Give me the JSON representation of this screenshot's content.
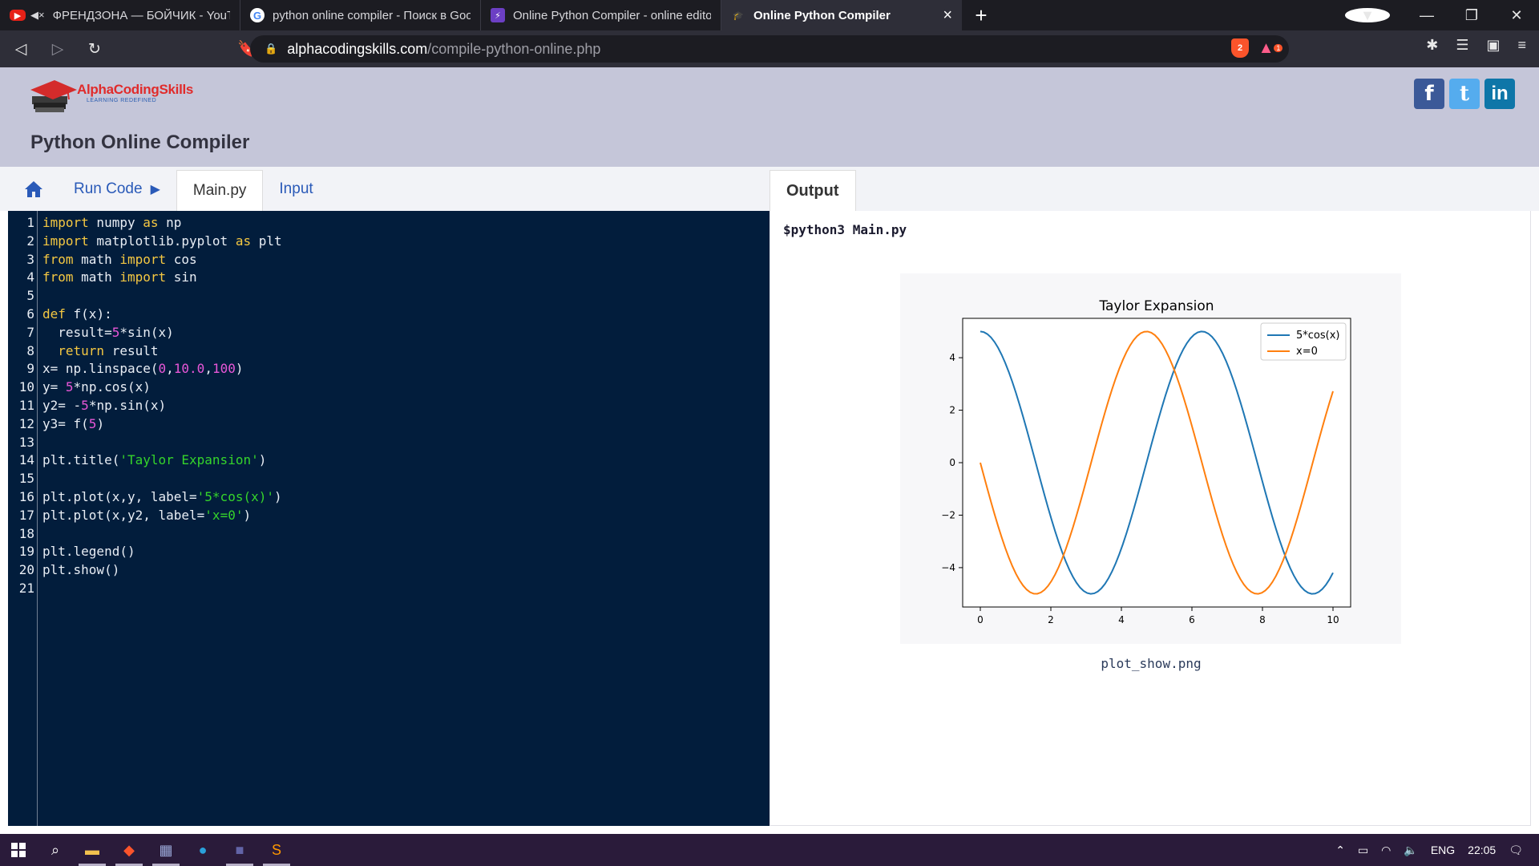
{
  "browser": {
    "tabs": [
      {
        "title": "ФРЕНДЗОНА — БОЙЧИК - YouTube",
        "favicon": "youtube-icon",
        "muted": true
      },
      {
        "title": "python online compiler - Поиск в Google",
        "favicon": "google-icon"
      },
      {
        "title": "Online Python Compiler - online editor",
        "favicon": "bolt-icon"
      },
      {
        "title": "Online Python Compiler",
        "favicon": "alphacodingskills-icon",
        "active": true
      }
    ],
    "url_domain": "alphacodingskills.com",
    "url_path": "/compile-python-online.php",
    "shield_count": "2",
    "rewards_count": "1"
  },
  "site": {
    "logo_text": "AlphaCodingSkills",
    "logo_subtext": "LEARNING REDEFINED",
    "page_title": "Python Online Compiler",
    "socials": [
      "f",
      "t",
      "in"
    ]
  },
  "editor_tabs": {
    "run_label": "Run Code",
    "main_label": "Main.py",
    "input_label": "Input"
  },
  "output_tab": "Output",
  "code_lines": [
    [
      [
        "kw",
        "import"
      ],
      [
        "t",
        " numpy "
      ],
      [
        "kw",
        "as"
      ],
      [
        "t",
        " np"
      ]
    ],
    [
      [
        "kw",
        "import"
      ],
      [
        "t",
        " matplotlib.pyplot "
      ],
      [
        "kw",
        "as"
      ],
      [
        "t",
        " plt"
      ]
    ],
    [
      [
        "kw",
        "from"
      ],
      [
        "t",
        " math "
      ],
      [
        "kw",
        "import"
      ],
      [
        "t",
        " cos"
      ]
    ],
    [
      [
        "kw",
        "from"
      ],
      [
        "t",
        " math "
      ],
      [
        "kw",
        "import"
      ],
      [
        "t",
        " sin"
      ]
    ],
    [],
    [
      [
        "kw",
        "def"
      ],
      [
        "t",
        " f(x):"
      ]
    ],
    [
      [
        "t",
        "  result="
      ],
      [
        "num",
        "5"
      ],
      [
        "t",
        "*sin(x)"
      ]
    ],
    [
      [
        "t",
        "  "
      ],
      [
        "kw",
        "return"
      ],
      [
        "t",
        " result"
      ]
    ],
    [
      [
        "t",
        "x= np.linspace("
      ],
      [
        "num",
        "0"
      ],
      [
        "t",
        ","
      ],
      [
        "num",
        "10.0"
      ],
      [
        "t",
        ","
      ],
      [
        "num",
        "100"
      ],
      [
        "t",
        ")"
      ]
    ],
    [
      [
        "t",
        "y= "
      ],
      [
        "num",
        "5"
      ],
      [
        "t",
        "*np.cos(x)"
      ]
    ],
    [
      [
        "t",
        "y2= -"
      ],
      [
        "num",
        "5"
      ],
      [
        "t",
        "*np.sin(x)"
      ]
    ],
    [
      [
        "t",
        "y3= f("
      ],
      [
        "num",
        "5"
      ],
      [
        "t",
        ")"
      ]
    ],
    [],
    [
      [
        "t",
        "plt.title("
      ],
      [
        "str",
        "'Taylor Expansion'"
      ],
      [
        "t",
        ")"
      ]
    ],
    [],
    [
      [
        "t",
        "plt.plot(x,y, label="
      ],
      [
        "str",
        "'5*cos(x)'"
      ],
      [
        "t",
        ")"
      ]
    ],
    [
      [
        "t",
        "plt.plot(x,y2, label="
      ],
      [
        "str",
        "'x=0'"
      ],
      [
        "t",
        ")"
      ]
    ],
    [],
    [
      [
        "t",
        "plt.legend()"
      ]
    ],
    [
      [
        "t",
        "plt.show()"
      ]
    ],
    []
  ],
  "output": {
    "command": "$python3 Main.py",
    "image_caption": "plot_show.png"
  },
  "chart_data": {
    "type": "line",
    "title": "Taylor Expansion",
    "xlabel": "",
    "ylabel": "",
    "xlim": [
      -0.5,
      10.5
    ],
    "ylim": [
      -5.5,
      5.5
    ],
    "xticks": [
      0,
      2,
      4,
      6,
      8,
      10
    ],
    "xtick_labels": [
      "0",
      "2",
      "4",
      "6",
      "8",
      "10"
    ],
    "yticks": [
      4,
      2,
      0,
      -2,
      -4
    ],
    "ytick_labels": [
      "4",
      "2",
      "0",
      "−2",
      "−4"
    ],
    "legend_position": "top-right",
    "grid": false,
    "x_range": [
      0,
      10
    ],
    "n_points": 100,
    "series": [
      {
        "name": "5*cos(x)",
        "expression": "5*cos(x)",
        "color": "#1f77b4"
      },
      {
        "name": "x=0",
        "expression": "-5*sin(x)",
        "color": "#ff7f0e"
      }
    ]
  },
  "taskbar": {
    "language": "ENG",
    "time": "22:05"
  },
  "colors": {
    "editor_bg": "#021d3c",
    "keyword": "#f5c842",
    "number": "#e957d8",
    "string": "#35d42b",
    "header_bg": "#c5c6d9",
    "link": "#2a5ab8"
  }
}
